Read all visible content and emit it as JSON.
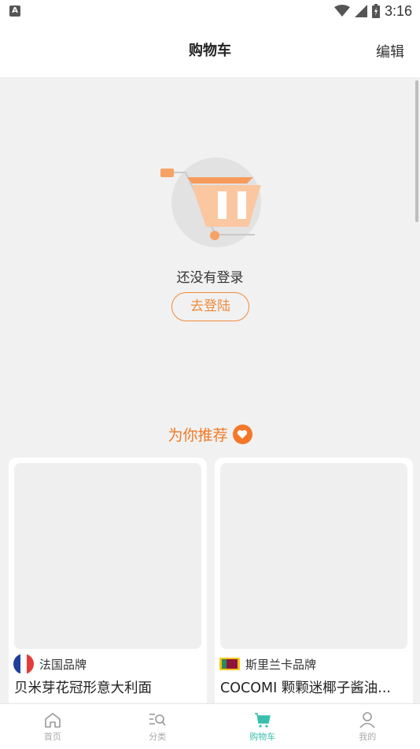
{
  "status_bar": {
    "notification_icon_letter": "A",
    "time": "3:16",
    "icons": [
      "wifi-icon",
      "signal-icon",
      "battery-icon"
    ]
  },
  "header": {
    "title": "购物车",
    "edit_label": "编辑"
  },
  "empty_state": {
    "message": "还没有登录",
    "login_button": "去登陆",
    "illustration": "empty-cart-icon"
  },
  "recommend": {
    "title": "为你推荐",
    "icon": "heart-icon"
  },
  "products": [
    {
      "flag": "france-flag-icon",
      "brand": "法国品牌",
      "name": "贝米芽花冠形意大利面"
    },
    {
      "flag": "sri-lanka-flag-icon",
      "brand": "斯里兰卡品牌",
      "name": "COCOMI 颗颗迷椰子酱油..."
    }
  ],
  "tabs": [
    {
      "label": "首页",
      "icon": "home-icon"
    },
    {
      "label": "分类",
      "icon": "category-search-icon"
    },
    {
      "label": "购物车",
      "icon": "cart-icon",
      "active": true
    },
    {
      "label": "我的",
      "icon": "user-icon"
    }
  ],
  "colors": {
    "accent": "#f07a24",
    "tab_active": "#3bbfad",
    "background": "#f1f1f1"
  }
}
